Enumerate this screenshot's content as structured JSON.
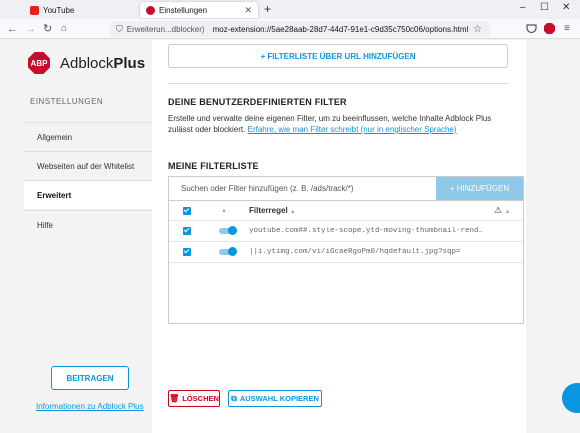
{
  "browser": {
    "tabs": [
      {
        "label": "YouTube",
        "icon": "youtube-icon"
      },
      {
        "label": "Einstellungen",
        "icon": "adblockplus-icon"
      }
    ],
    "url_identity": "Erweiterun...dblocker)",
    "url": "moz-extension://5ae28aab-28d7-44d7-91e1-c9d35c750c06/options.html"
  },
  "sidebar": {
    "logo_text": "ABP",
    "brand_prefix": "Adblock",
    "brand_suffix": "Plus",
    "heading": "EINSTELLUNGEN",
    "items": [
      {
        "label": "Allgemein"
      },
      {
        "label": "Webseiten auf der Whitelist"
      },
      {
        "label": "Erweitert"
      },
      {
        "label": "Hilfe"
      }
    ],
    "contribute": "BEITRAGEN",
    "info_link": "Informationen zu Adblock Plus"
  },
  "main": {
    "add_url_button": "+ FILTERLISTE ÜBER URL HINZUFÜGEN",
    "custom_heading": "DEINE BENUTZERDEFINIERTEN FILTER",
    "custom_desc": "Erstelle und verwalte deine eigenen Filter, um zu beeinflussen, welche Inhalte Adblock Plus zulässt oder blockiert.",
    "custom_link": "Erfahre, wie man Filter schreibt (nur in englischer Sprache)",
    "filterlist_heading": "MEINE FILTERLISTE",
    "search_placeholder": "Suchen oder Filter hinzufügen (z. B. /ads/track/*)",
    "add_button": "+ HINZUFÜGEN",
    "column_header": "Filterregel",
    "rules": [
      {
        "text": "youtube.com##.style-scope.ytd-moving-thumbnail-renderer"
      },
      {
        "text": "||i.ytimg.com/vi/iGcaeRgoPm0/hqdefault.jpg?sqp="
      }
    ],
    "delete_button": "LÖSCHEN",
    "copy_button": "AUSWAHL KOPIEREN"
  },
  "colors": {
    "accent": "#0797e1",
    "danger": "#d0021b",
    "brand_red": "#c70d2c"
  }
}
